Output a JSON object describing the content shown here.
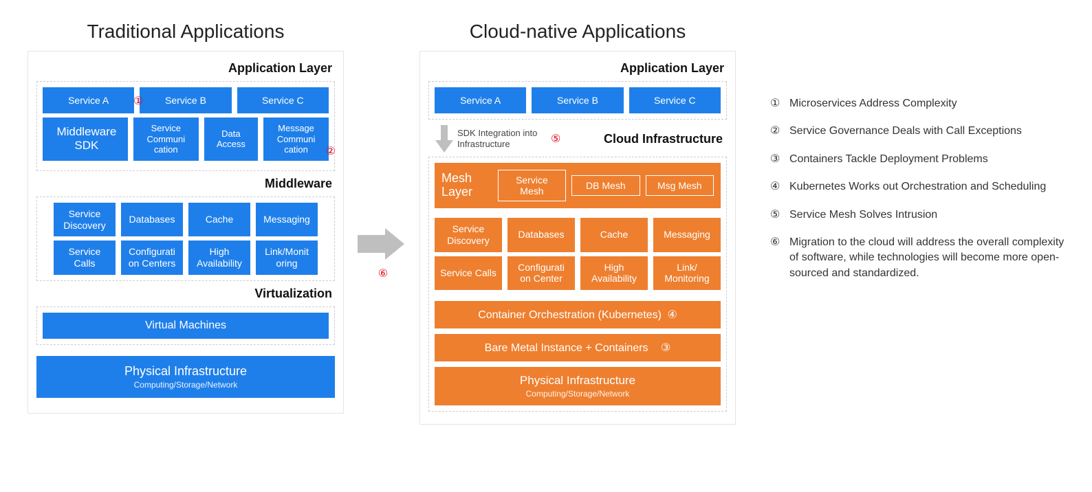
{
  "traditional": {
    "title": "Traditional Applications",
    "app_layer_title": "Application Layer",
    "services": [
      "Service A",
      "Service B",
      "Service C"
    ],
    "sdk_row": {
      "sdk": "Middleware SDK",
      "items": [
        "Service Communi cation",
        "Data Access",
        "Message Communi cation"
      ]
    },
    "middleware_title": "Middleware",
    "middleware_row1": [
      "Service Discovery",
      "Databases",
      "Cache",
      "Messaging"
    ],
    "middleware_row2": [
      "Service Calls",
      "Configurati on Centers",
      "High Availability",
      "Link/Monit oring"
    ],
    "virtualization_title": "Virtualization",
    "vm": "Virtual Machines",
    "phys": "Physical Infrastructure",
    "phys_sub": "Computing/Storage/Network"
  },
  "cloud": {
    "title": "Cloud-native Applications",
    "app_layer_title": "Application Layer",
    "services": [
      "Service A",
      "Service B",
      "Service C"
    ],
    "sdk_note": "SDK Integration into Infrastructure",
    "cloud_infra_title": "Cloud Infrastructure",
    "mesh_label": "Mesh Layer",
    "mesh_items": [
      "Service Mesh",
      "DB Mesh",
      "Msg Mesh"
    ],
    "infra_row1": [
      "Service Discovery",
      "Databases",
      "Cache",
      "Messaging"
    ],
    "infra_row2": [
      "Service Calls",
      "Configurati on Center",
      "High Availability",
      "Link/ Monitoring"
    ],
    "orchestration": "Container Orchestration (Kubernetes)",
    "baremetal": "Bare Metal Instance + Containers",
    "phys": "Physical Infrastructure",
    "phys_sub": "Computing/Storage/Network"
  },
  "badges": {
    "b1": "①",
    "b2": "②",
    "b3": "③",
    "b4": "④",
    "b5": "⑤",
    "b6": "⑥"
  },
  "legend": {
    "items": [
      {
        "num": "①",
        "text": "Microservices Address Complexity"
      },
      {
        "num": "②",
        "text": "Service Governance Deals with Call Exceptions"
      },
      {
        "num": "③",
        "text": "Containers Tackle Deployment Problems"
      },
      {
        "num": "④",
        "text": "Kubernetes Works out Orchestration and Scheduling"
      },
      {
        "num": "⑤",
        "text": "Service Mesh Solves Intrusion"
      },
      {
        "num": "⑥",
        "text": "Migration to the cloud will address the overall complexity of software, while technologies will become more open-sourced and standardized."
      }
    ]
  }
}
